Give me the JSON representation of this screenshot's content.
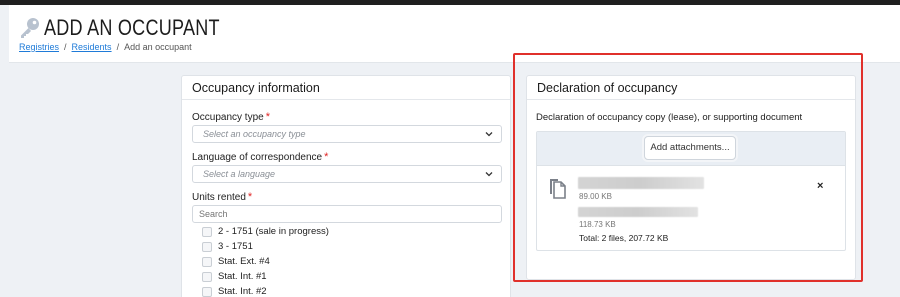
{
  "header": {
    "title": "ADD AN OCCUPANT",
    "breadcrumb": [
      {
        "label": "Registries"
      },
      {
        "label": "Residents"
      },
      {
        "label": "Add an occupant"
      }
    ],
    "separator": "/"
  },
  "occupancy": {
    "title": "Occupancy information",
    "type_label": "Occupancy type",
    "type_placeholder": "Select an occupancy type",
    "language_label": "Language of correspondence",
    "language_placeholder": "Select a language",
    "units_label": "Units rented",
    "search_placeholder": "Search",
    "required_mark": "*",
    "units": [
      "2 - 1751 (sale in progress)",
      "3 - 1751",
      "Stat. Ext. #4",
      "Stat. Int. #1",
      "Stat. Int. #2"
    ]
  },
  "declaration": {
    "title": "Declaration of occupancy",
    "description": "Declaration of occupancy copy (lease), or supporting document",
    "add_button": "Add attachments...",
    "files": [
      {
        "size": "89.00 KB"
      },
      {
        "size": "118.73 KB"
      }
    ],
    "total": "Total: 2 files, 207.72 KB",
    "remove": "×"
  },
  "colors": {
    "accent": "#1f7bd8",
    "required": "#e02424",
    "highlight": "#e0302b"
  },
  "icons": [
    "key-icon",
    "chevron-down-icon",
    "copy-files-icon",
    "close-icon"
  ]
}
